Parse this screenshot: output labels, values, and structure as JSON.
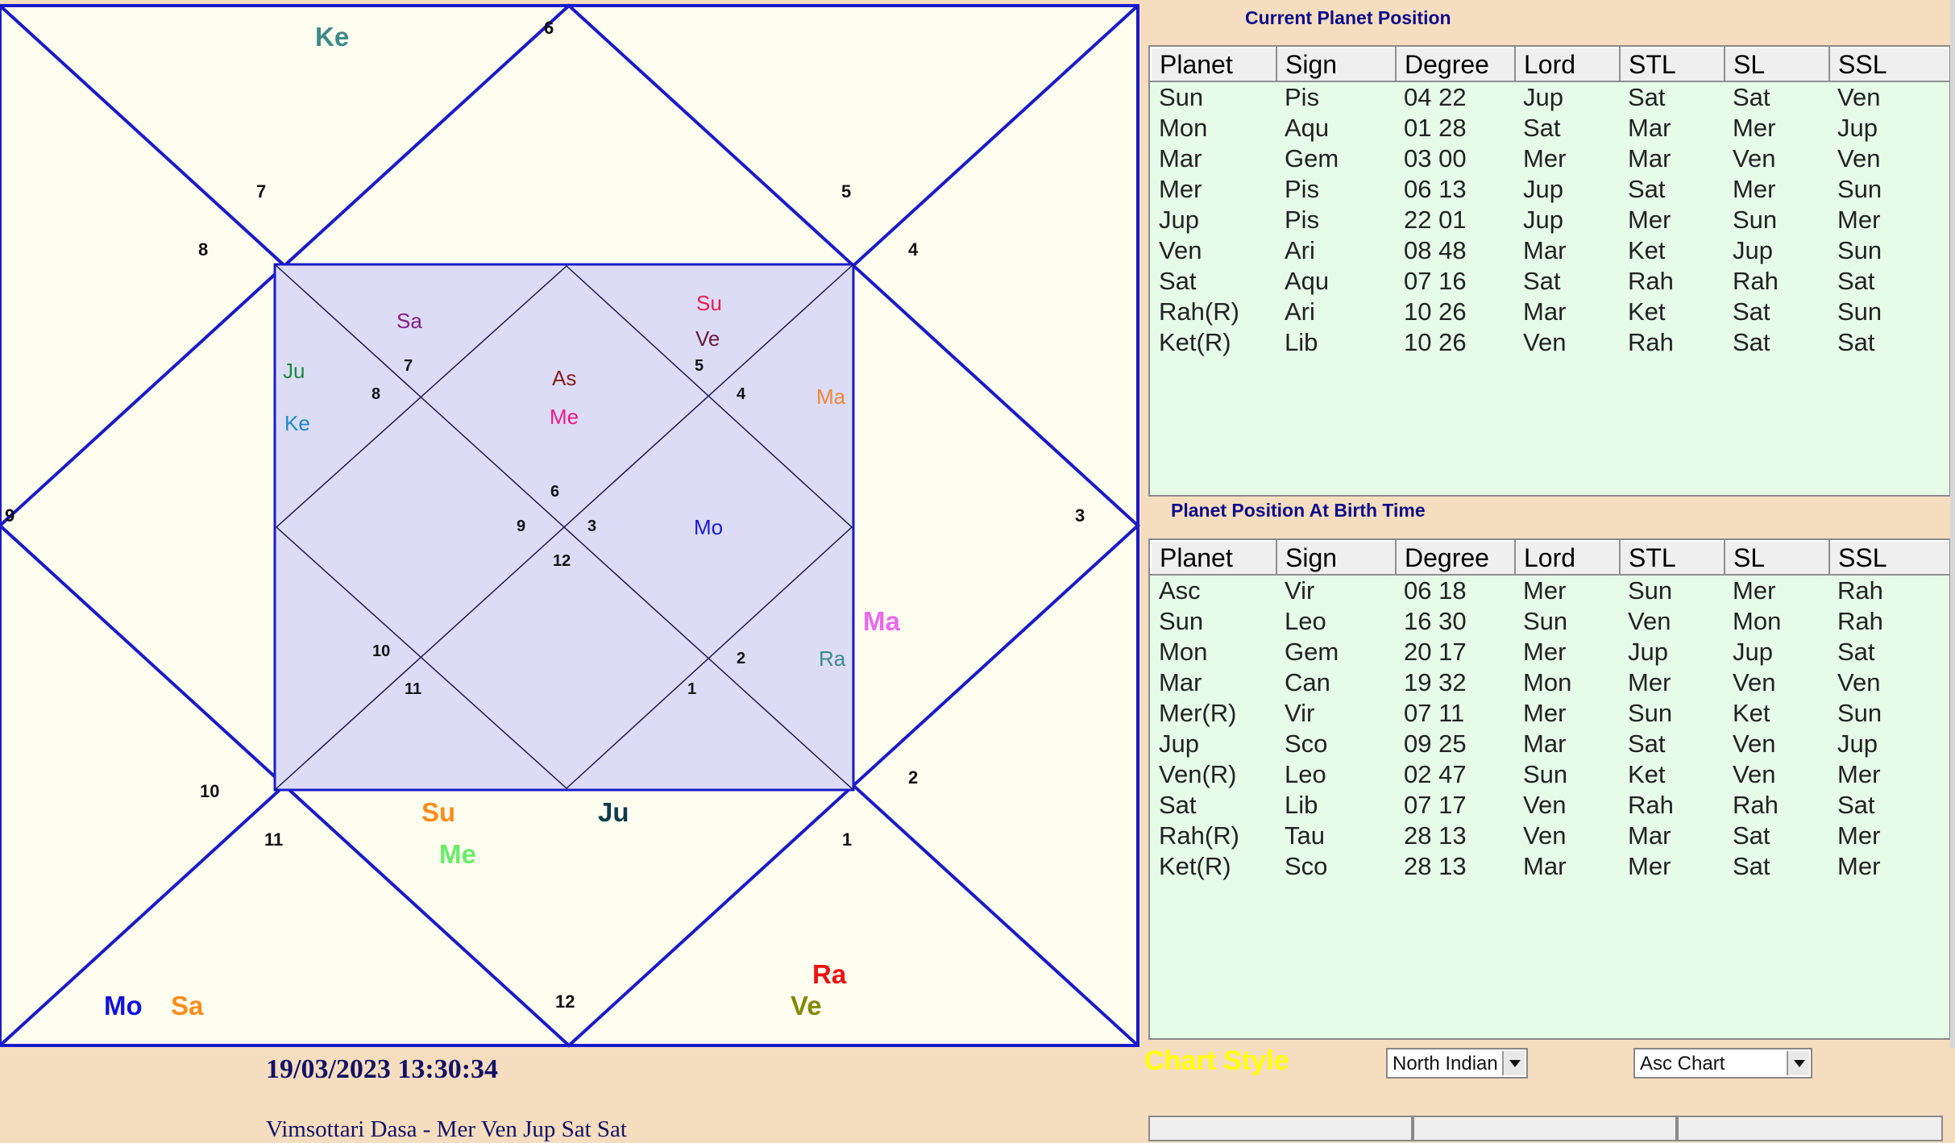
{
  "chart": {
    "outer_planets": [
      {
        "label": "Ke",
        "color": "#3f8a8a"
      },
      {
        "label": "Mo",
        "color": "#1111dd"
      },
      {
        "label": "Sa",
        "color": "#ff8c1a"
      },
      {
        "label": "Su",
        "color": "#ff8c1a"
      },
      {
        "label": "Me",
        "color": "#66ee66"
      },
      {
        "label": "Ju",
        "color": "#0d3d4d"
      },
      {
        "label": "Ra",
        "color": "#ee1111"
      },
      {
        "label": "Ve",
        "color": "#888800"
      },
      {
        "label": "Ma",
        "color": "#ee66ee"
      }
    ],
    "outer_numbers": [
      "6",
      "7",
      "5",
      "8",
      "4",
      "9",
      "3",
      "10",
      "2",
      "11",
      "1",
      "12"
    ],
    "inner_planets": [
      {
        "label": "Sa",
        "color": "#8a1a8a"
      },
      {
        "label": "Ju",
        "color": "#1a8a3a"
      },
      {
        "label": "Ke",
        "color": "#1a8acc"
      },
      {
        "label": "As",
        "color": "#8a1a1a"
      },
      {
        "label": "Me",
        "color": "#ee1a8a"
      },
      {
        "label": "Su",
        "color": "#ee1a4a"
      },
      {
        "label": "Ve",
        "color": "#6a1a3a"
      },
      {
        "label": "Ma",
        "color": "#ee8833"
      },
      {
        "label": "Mo",
        "color": "#1a1add"
      },
      {
        "label": "Ra",
        "color": "#3a8a8a"
      }
    ],
    "inner_numbers": [
      "7",
      "8",
      "5",
      "4",
      "6",
      "9",
      "3",
      "12",
      "10",
      "11",
      "2",
      "1"
    ]
  },
  "current_panel": {
    "title": "Current Planet Position",
    "headers": [
      "Planet",
      "Sign",
      "Degree",
      "Lord",
      "STL",
      "SL",
      "SSL"
    ],
    "rows": [
      [
        "Sun",
        "Pis",
        "04 22",
        "Jup",
        "Sat",
        "Sat",
        "Ven"
      ],
      [
        "Mon",
        "Aqu",
        "01 28",
        "Sat",
        "Mar",
        "Mer",
        "Jup"
      ],
      [
        "Mar",
        "Gem",
        "03 00",
        "Mer",
        "Mar",
        "Ven",
        "Ven"
      ],
      [
        "Mer",
        "Pis",
        "06 13",
        "Jup",
        "Sat",
        "Mer",
        "Sun"
      ],
      [
        "Jup",
        "Pis",
        "22 01",
        "Jup",
        "Mer",
        "Sun",
        "Mer"
      ],
      [
        "Ven",
        "Ari",
        "08 48",
        "Mar",
        "Ket",
        "Jup",
        "Sun"
      ],
      [
        "Sat",
        "Aqu",
        "07 16",
        "Sat",
        "Rah",
        "Rah",
        "Sat"
      ],
      [
        "Rah(R)",
        "Ari",
        "10 26",
        "Mar",
        "Ket",
        "Sat",
        "Sun"
      ],
      [
        "Ket(R)",
        "Lib",
        "10 26",
        "Ven",
        "Rah",
        "Sat",
        "Sat"
      ]
    ]
  },
  "birth_panel": {
    "title": "Planet Position At Birth Time",
    "headers": [
      "Planet",
      "Sign",
      "Degree",
      "Lord",
      "STL",
      "SL",
      "SSL"
    ],
    "rows": [
      [
        "Asc",
        "Vir",
        "06 18",
        "Mer",
        "Sun",
        "Mer",
        "Rah"
      ],
      [
        "Sun",
        "Leo",
        "16 30",
        "Sun",
        "Ven",
        "Mon",
        "Rah"
      ],
      [
        "Mon",
        "Gem",
        "20 17",
        "Mer",
        "Jup",
        "Jup",
        "Sat"
      ],
      [
        "Mar",
        "Can",
        "19 32",
        "Mon",
        "Mer",
        "Ven",
        "Ven"
      ],
      [
        "Mer(R)",
        "Vir",
        "07 11",
        "Mer",
        "Sun",
        "Ket",
        "Sun"
      ],
      [
        "Jup",
        "Sco",
        "09 25",
        "Mar",
        "Sat",
        "Ven",
        "Jup"
      ],
      [
        "Ven(R)",
        "Leo",
        "02 47",
        "Sun",
        "Ket",
        "Ven",
        "Mer"
      ],
      [
        "Sat",
        "Lib",
        "07 17",
        "Ven",
        "Rah",
        "Rah",
        "Sat"
      ],
      [
        "Rah(R)",
        "Tau",
        "28 13",
        "Ven",
        "Mar",
        "Sat",
        "Mer"
      ],
      [
        "Ket(R)",
        "Sco",
        "28 13",
        "Mar",
        "Mer",
        "Sat",
        "Mer"
      ]
    ]
  },
  "footer": {
    "datetime": "19/03/2023 13:30:34",
    "dasa": "Vimsottari Dasa -  Mer Ven Jup Sat Sat",
    "chart_style_label": "Chart Style",
    "style_select": "North Indian",
    "chart_select": "Asc Chart"
  },
  "colors": {
    "chart_line": "#1a1acc",
    "outer_fill": "#fefef0",
    "inner_fill": "#dcdcf6",
    "panel_bg": "#e7fbe9"
  }
}
